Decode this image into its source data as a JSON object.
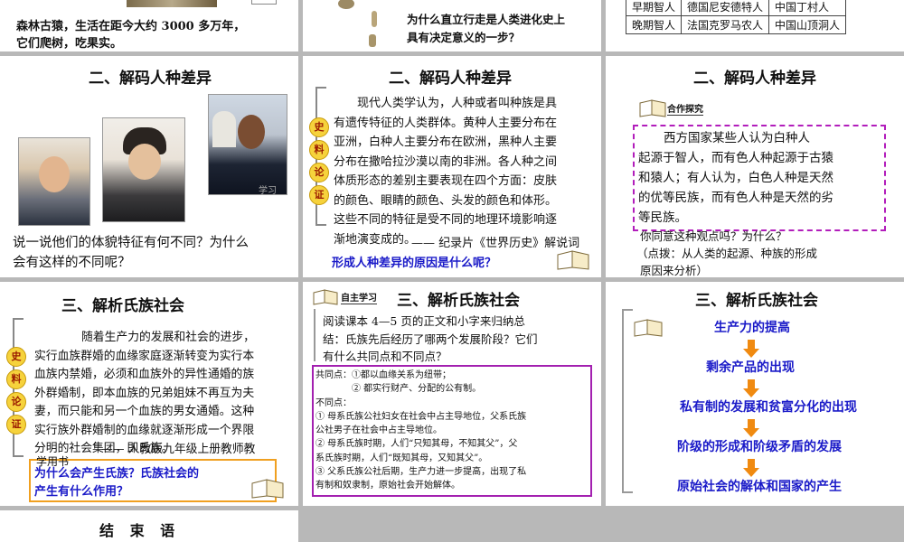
{
  "slide_top_left": {
    "caption_line1": "森林古猿，生活在距今大约 3000 多万年，",
    "caption_line2": "它们爬树，吃果实。"
  },
  "slide_top_mid": {
    "question_line1": "为什么直立行走是人类进化史上",
    "question_line2": "具有决定意义的一步？"
  },
  "slide_top_right": {
    "rows": [
      [
        "早期智人",
        "德国尼安德特人",
        "中国丁村人"
      ],
      [
        "晚期智人",
        "法国克罗马农人",
        "中国山顶洞人"
      ]
    ]
  },
  "slide_mid_left": {
    "title": "二、解码人种差异",
    "watermark": "学习",
    "question_line1": "说一说他们的体貌特征有何不同？为什么",
    "question_line2": "会有这样的不同呢？"
  },
  "slide_mid_center": {
    "title": "二、解码人种差异",
    "badge": [
      "史",
      "料",
      "论",
      "证"
    ],
    "lines": [
      "现代人类学认为，人种或者叫种族是具",
      "有遗传特征的人类群体。黄种人主要分布在",
      "亚洲，白种人主要分布在欧洲，黑种人主要",
      "分布在撒哈拉沙漠以南的非洲。各人种之间",
      "体质形态的差别主要表现在四个方面：皮肤",
      "的颜色、眼睛的颜色、头发的颜色和体形。",
      "这些不同的特征是受不同的地理环境影响逐",
      "渐地演变成的。"
    ],
    "source": "—— 纪录片《世界历史》解说词",
    "question": "形成人种差异的原因是什么呢？"
  },
  "slide_mid_right": {
    "title": "二、解码人种差异",
    "tag": "合作探究",
    "lines": [
      "西方国家某些人认为白种人",
      "起源于智人，而有色人种起源于古猿",
      "和猿人；有人认为，白色人种是天然",
      "的优等民族，而有色人种是天然的劣",
      "等民族。"
    ],
    "question": "你同意这种观点吗？为什么？",
    "hint_line1": "（点拨：从人类的起源、种族的形成",
    "hint_line2": "原因来分析）"
  },
  "slide_bot_left": {
    "title": "三、解析氏族社会",
    "badge": [
      "史",
      "料",
      "论",
      "证"
    ],
    "lines": [
      "随着生产力的发展和社会的进步，",
      "实行血族群婚的血缘家庭逐渐转变为实行本",
      "血族内禁婚，必须和血族外的异性通婚的族",
      "外群婚制，即本血族的兄弟姐妹不再互为夫",
      "妻，而只能和另一个血族的男女通婚。这种",
      "实行族外群婚制的血缘就逐渐形成一个界限",
      "分明的社会集团，即氏族。"
    ],
    "source": "—— 人教版九年级上册教师教",
    "source_tail": "学用书",
    "question_line1": "为什么会产生氏族？氏族社会的",
    "question_line2": "产生有什么作用？"
  },
  "slide_bot_center": {
    "tag": "自主学习",
    "title": "三、解析氏族社会",
    "task_lines": [
      "阅读课本 4—5 页的正文和小字来归纳总",
      "结：氏族先后经历了哪两个发展阶段？它们",
      "有什么共同点和不同点？"
    ],
    "answer_lines": [
      "共同点：①都以血缘关系为纽带；",
      "　　　　② 都实行财产、分配的公有制。",
      "不同点：",
      "① 母系氏族公社妇女在社会中占主导地位，父系氏族",
      "公社男子在社会中占主导地位。",
      "② 母系氏族时期，人们“只知其母，不知其父”，父",
      "系氏族时期，人们“既知其母，又知其父”。",
      "③ 父系氏族公社后期，生产力进一步提高，出现了私",
      "有制和奴隶制，原始社会开始解体。"
    ]
  },
  "slide_bot_right": {
    "title": "三、解析氏族社会",
    "flow": [
      "生产力的提高",
      "剩余产品的出现",
      "私有制的发展和贫富分化的出现",
      "阶级的形成和阶级矛盾的发展",
      "原始社会的解体和国家的产生"
    ]
  },
  "slide_end": {
    "title": "结 束 语"
  }
}
